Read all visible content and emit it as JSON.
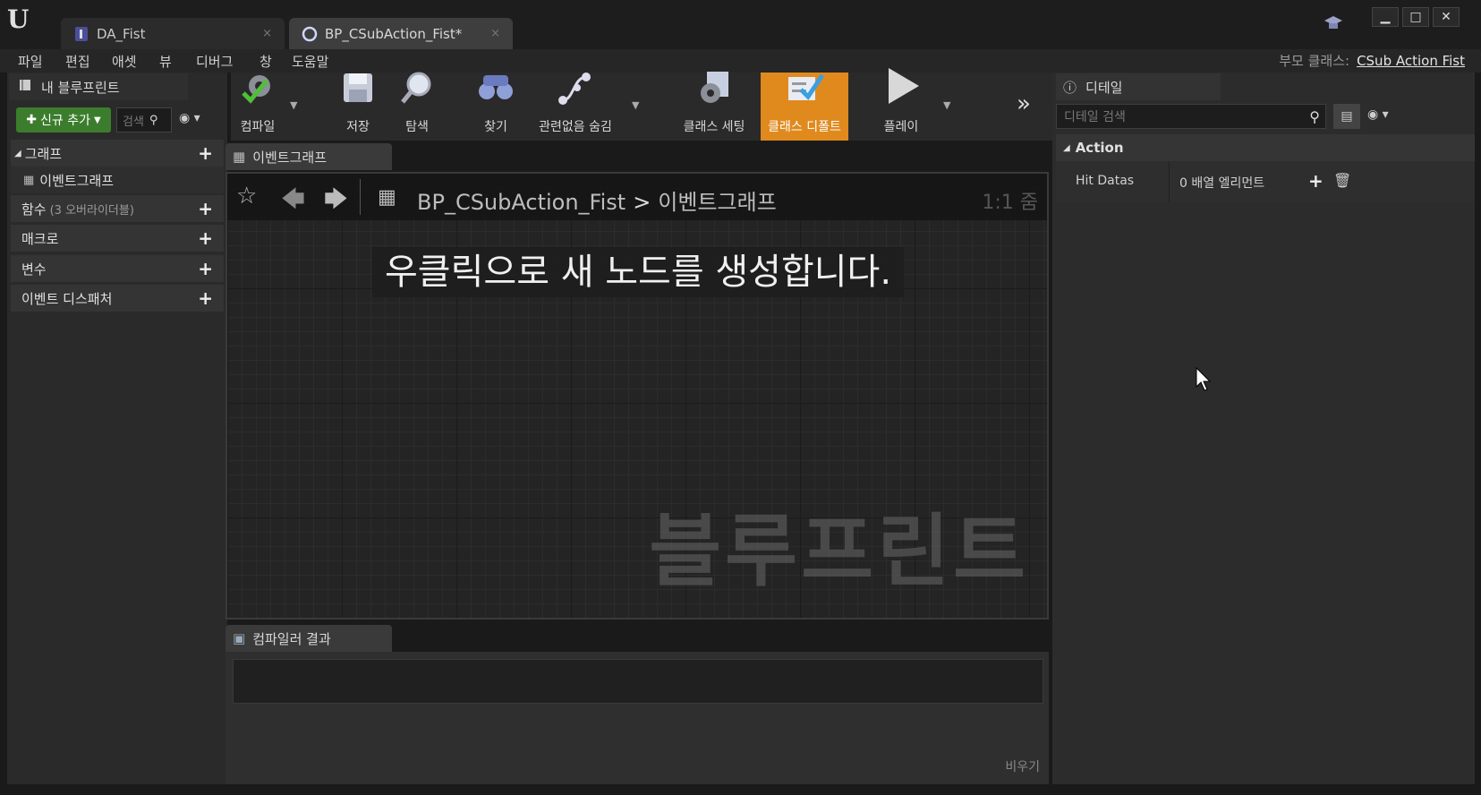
{
  "tabs": [
    {
      "label": "DA_Fist",
      "close": "×"
    },
    {
      "label": "BP_CSubAction_Fist*",
      "close": "×"
    }
  ],
  "window": {
    "minimize": "▁",
    "maximize": "□",
    "close": "✕"
  },
  "menu": [
    "파일",
    "편집",
    "애셋",
    "뷰",
    "디버그",
    "창",
    "도움말"
  ],
  "parent_class": {
    "label": "부모 클래스:",
    "value": "CSub Action Fist"
  },
  "my_blueprint": {
    "tab_label": "내 블루프린트",
    "add_new": "신규 추가",
    "search_placeholder": "검색",
    "categories": [
      {
        "label": "그래프",
        "sub": ""
      },
      {
        "label": "이벤트그래프",
        "sub": ""
      },
      {
        "label": "함수",
        "sub": "(3 오버라이더블)"
      },
      {
        "label": "매크로",
        "sub": ""
      },
      {
        "label": "변수",
        "sub": ""
      },
      {
        "label": "이벤트 디스패처",
        "sub": ""
      }
    ]
  },
  "toolbar": {
    "compile": "컴파일",
    "save": "저장",
    "browse": "탐색",
    "find": "찾기",
    "hide_unrelated": "관련없음 숨김",
    "class_settings": "클래스 세팅",
    "class_defaults": "클래스 디폴트",
    "play": "플레이"
  },
  "graph": {
    "tab_label": "이벤트그래프",
    "breadcrumb_root": "BP_CSubAction_Fist",
    "breadcrumb_sep": ">",
    "breadcrumb_leaf": "이벤트그래프",
    "zoom": "1:1 줌",
    "hint": "우클릭으로 새 노드를 생성합니다.",
    "watermark": "블루프린트"
  },
  "compiler": {
    "tab_label": "컴파일러 결과",
    "clear": "비우기"
  },
  "details": {
    "tab_label": "디테일",
    "search_placeholder": "디테일 검색",
    "category": "Action",
    "properties": [
      {
        "label": "Hit Datas",
        "value": "0 배열 엘리먼트"
      }
    ]
  }
}
